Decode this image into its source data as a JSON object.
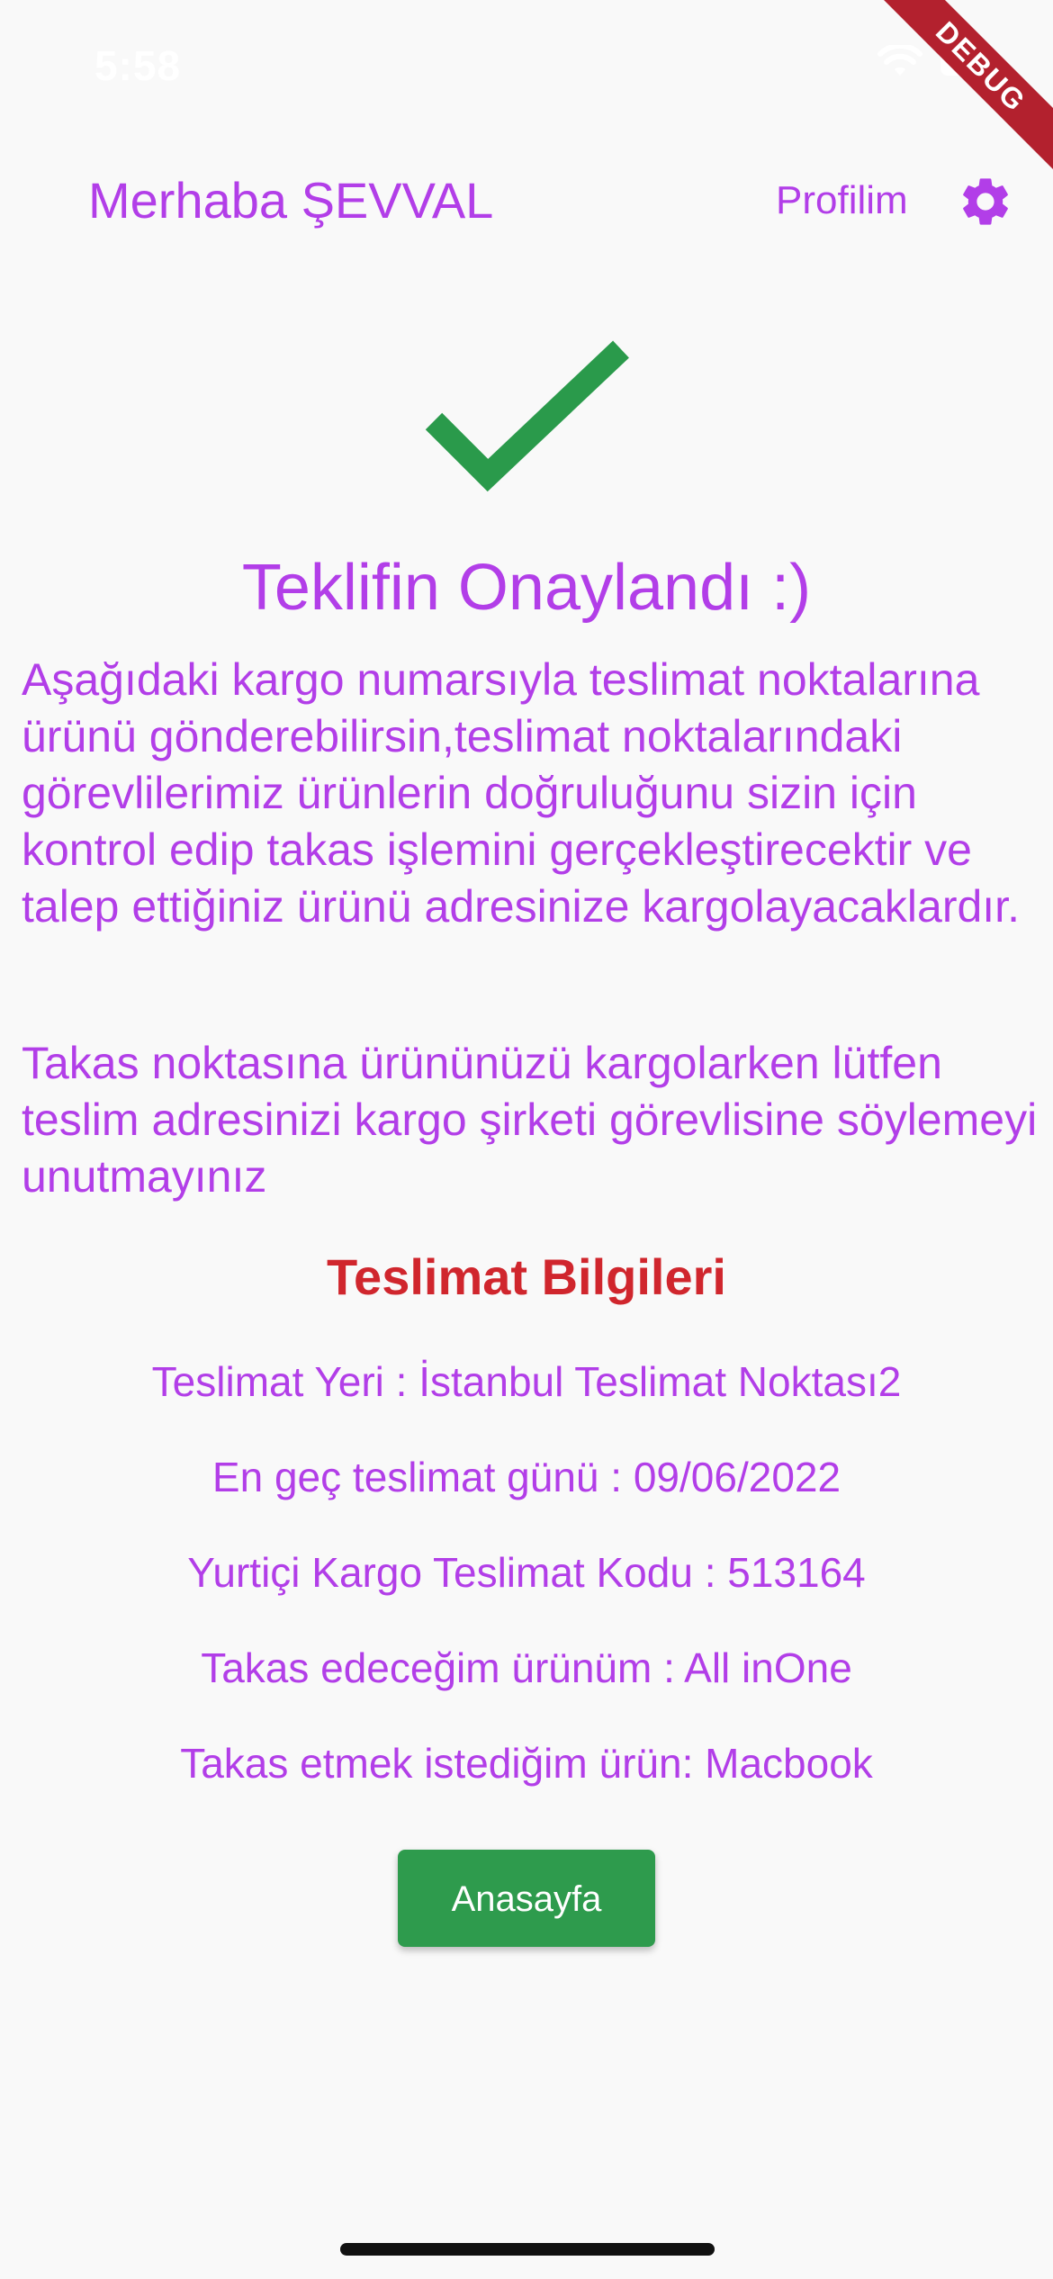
{
  "status_bar": {
    "time": "5:58"
  },
  "debug_banner": "DEBUG",
  "header": {
    "greeting": "Merhaba ŞEVVAL",
    "profile_label": "Profilim"
  },
  "confirmation": {
    "title": "Teklifin Onaylandı :)",
    "paragraph_1": "Aşağıdaki kargo numarsıyla teslimat noktalarına ürünü gönderebilirsin,teslimat noktalarındaki görevlilerimiz ürünlerin doğruluğunu sizin için kontrol edip takas işlemini gerçekleştirecektir ve talep ettiğiniz ürünü adresinize kargolayacaklardır.",
    "paragraph_2": "Takas noktasına ürününüzü kargolarken lütfen teslim adresinizi kargo şirketi görevlisine söylemeyi unutmayınız"
  },
  "delivery_info": {
    "title": "Teslimat Bilgileri",
    "lines": [
      "Teslimat Yeri : İstanbul Teslimat Noktası2",
      "En geç teslimat günü : 09/06/2022",
      "Yurtiçi Kargo Teslimat Kodu : 513164",
      "Takas edeceğim ürünüm : All inOne",
      "Takas etmek istediğim ürün: Macbook"
    ]
  },
  "actions": {
    "home_label": "Anasayfa"
  },
  "colors": {
    "primary_text": "#b23ee8",
    "accent_red": "#d0262d",
    "button_green": "#2e9b4d",
    "check_green": "#2a9a4b"
  },
  "icons": {
    "settings": "gear-icon",
    "success": "check-icon"
  }
}
